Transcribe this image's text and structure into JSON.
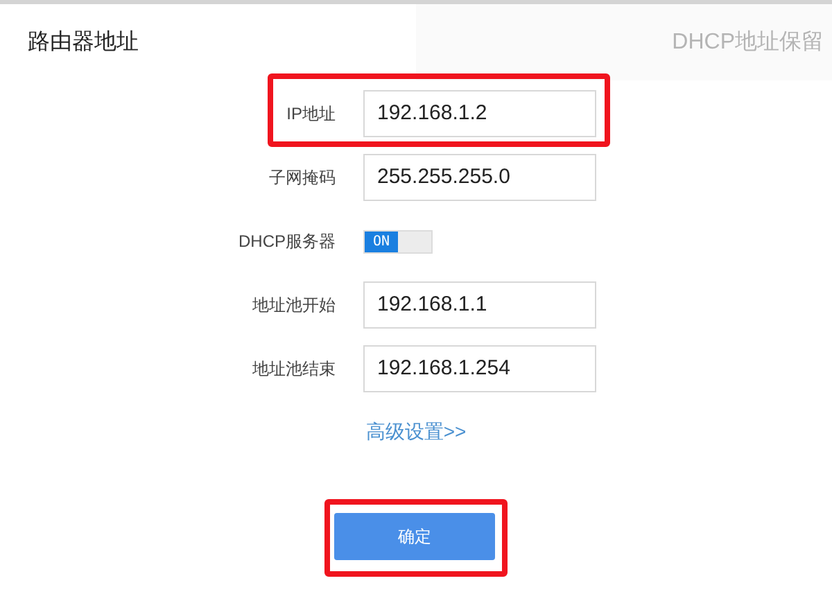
{
  "tabs": [
    {
      "label": "路由器地址",
      "selected": true
    },
    {
      "label": "DHCP地址保留",
      "selected": false
    }
  ],
  "fields": [
    {
      "kind": "input",
      "label": "IP地址",
      "value": "192.168.1.2",
      "highlighted": true
    },
    {
      "kind": "input",
      "label": "子网掩码",
      "value": "255.255.255.0",
      "highlighted": false
    },
    {
      "kind": "toggle",
      "label": "DHCP服务器",
      "on": true,
      "text": "ON",
      "highlighted": false
    },
    {
      "kind": "input",
      "label": "地址池开始",
      "value": "192.168.1.1",
      "highlighted": false
    },
    {
      "kind": "input",
      "label": "地址池结束",
      "value": "192.168.1.254",
      "highlighted": false
    }
  ],
  "advanced_link": "高级设置>>",
  "confirm_button": {
    "label": "确定",
    "highlighted": true
  }
}
